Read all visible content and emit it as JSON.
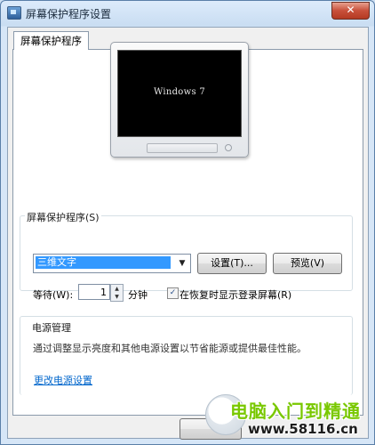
{
  "window": {
    "title": "屏幕保护程序设置",
    "close_glyph": "✕"
  },
  "tab": {
    "label": "屏幕保护程序"
  },
  "preview": {
    "screen_text": "Windows 7"
  },
  "screensaver": {
    "group_label": "屏幕保护程序(S)",
    "selected": "三维文字",
    "dropdown_arrow": "▼",
    "settings_button": "设置(T)...",
    "preview_button": "预览(V)",
    "wait_label": "等待(W):",
    "wait_value": "1",
    "minutes_label": "分钟",
    "resume_checked": true,
    "resume_check_glyph": "✓",
    "resume_label": "在恢复时显示登录屏幕(R)"
  },
  "power": {
    "group_label": "电源管理",
    "description": "通过调整显示亮度和其他电源设置以节省能源或提供最佳性能。",
    "link": "更改电源设置"
  },
  "watermark": {
    "line1": "电脑入门到精通",
    "line2": "www.58116.cn"
  },
  "icons": {
    "app": "monitor-icon",
    "spin_up": "▲",
    "spin_down": "▼"
  }
}
